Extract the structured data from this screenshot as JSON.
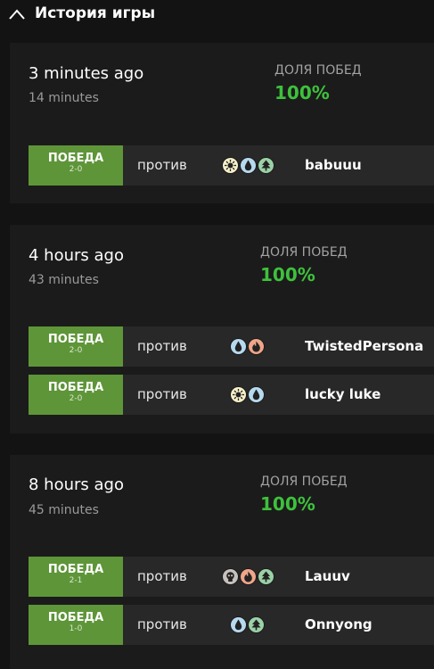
{
  "header": {
    "title": "История игры"
  },
  "icons": {
    "white": "sun-mana-icon",
    "blue": "water-drop-mana-icon",
    "black": "skull-mana-icon",
    "red": "fire-mana-icon",
    "green": "tree-mana-icon"
  },
  "colors": {
    "win_badge": "#5e9539",
    "win_pct": "#3ec13c",
    "row_bg": "#282828",
    "section_bg": "#1b1b1b"
  },
  "sessions": [
    {
      "time": "3 minutes ago",
      "duration": "14 minutes",
      "winrate_label": "ДОЛЯ ПОБЕД",
      "winrate": "100%",
      "matches": [
        {
          "result": "ПОБЕДА",
          "score": "2-0",
          "vs": "против",
          "mana": [
            "W",
            "U",
            "G"
          ],
          "opponent": "babuuu"
        }
      ]
    },
    {
      "time": "4 hours ago",
      "duration": "43 minutes",
      "winrate_label": "ДОЛЯ ПОБЕД",
      "winrate": "100%",
      "matches": [
        {
          "result": "ПОБЕДА",
          "score": "2-0",
          "vs": "против",
          "mana": [
            "U",
            "R"
          ],
          "opponent": "TwistedPersona"
        },
        {
          "result": "ПОБЕДА",
          "score": "2-0",
          "vs": "против",
          "mana": [
            "W",
            "U"
          ],
          "opponent": "lucky luke"
        }
      ]
    },
    {
      "time": "8 hours ago",
      "duration": "45 minutes",
      "winrate_label": "ДОЛЯ ПОБЕД",
      "winrate": "100%",
      "matches": [
        {
          "result": "ПОБЕДА",
          "score": "2-1",
          "vs": "против",
          "mana": [
            "B",
            "R",
            "G"
          ],
          "opponent": "Lauuv"
        },
        {
          "result": "ПОБЕДА",
          "score": "1-0",
          "vs": "против",
          "mana": [
            "U",
            "G"
          ],
          "opponent": "Onnyong"
        }
      ]
    }
  ]
}
